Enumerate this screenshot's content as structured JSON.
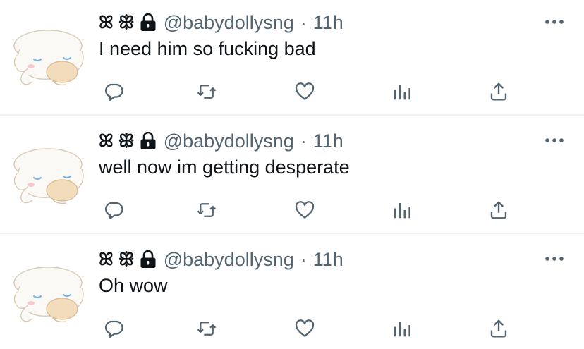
{
  "tweets": [
    {
      "name_glyphs": "ꕤ ꕥ",
      "handle": "@babydollysng",
      "separator": "·",
      "time": "11h",
      "text": "I need him so fucking bad"
    },
    {
      "name_glyphs": "ꕤ ꕥ",
      "handle": "@babydollysng",
      "separator": "·",
      "time": "11h",
      "text": "well now im getting desperate"
    },
    {
      "name_glyphs": "ꕤ ꕥ",
      "handle": "@babydollysng",
      "separator": "·",
      "time": "11h",
      "text": "Oh wow"
    }
  ],
  "icons": {
    "avatar": "cinnamoroll-avatar",
    "name_badge": "lock-icon",
    "more": "more-horizontal-icon",
    "actions": [
      "reply-icon",
      "retweet-icon",
      "like-icon",
      "analytics-icon",
      "share-icon"
    ]
  },
  "colors": {
    "text": "#0f1419",
    "secondary": "#536471",
    "separator": "#eff3f4",
    "icon": "#536471"
  }
}
